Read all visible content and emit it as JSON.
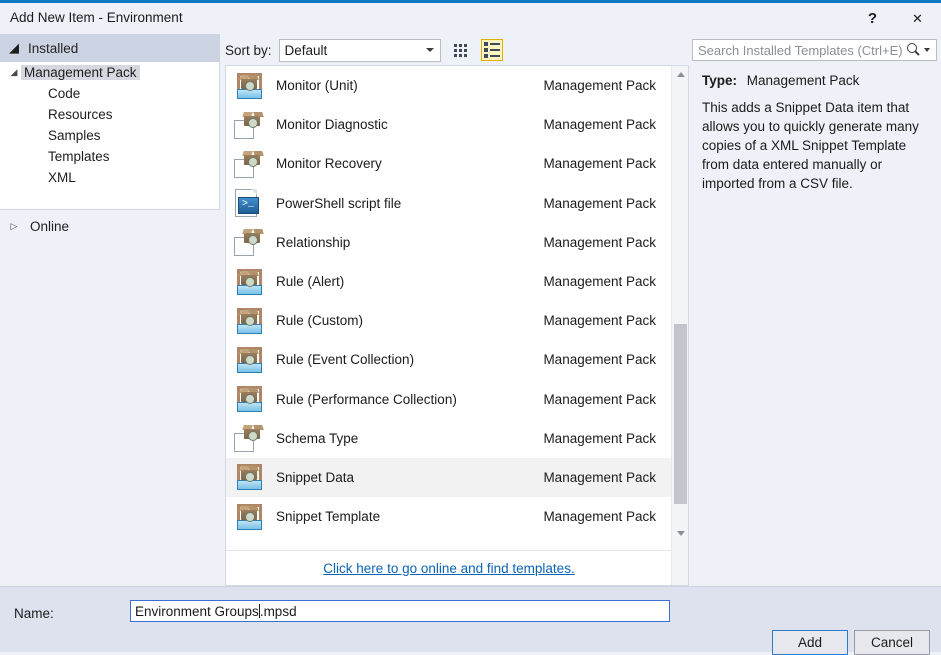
{
  "window": {
    "title": "Add New Item - Environment",
    "help_label": "?",
    "close_label": "✕"
  },
  "sidebar": {
    "installed": {
      "label": "Installed",
      "caret": "◢"
    },
    "tree": [
      {
        "label": "Management Pack",
        "level": 1,
        "caret": "◢",
        "selected": true
      },
      {
        "label": "Code",
        "level": 2,
        "caret": "",
        "selected": false
      },
      {
        "label": "Resources",
        "level": 2,
        "caret": "",
        "selected": false
      },
      {
        "label": "Samples",
        "level": 2,
        "caret": "",
        "selected": false
      },
      {
        "label": "Templates",
        "level": 2,
        "caret": "",
        "selected": false
      },
      {
        "label": "XML",
        "level": 2,
        "caret": "",
        "selected": false
      }
    ],
    "online": {
      "label": "Online",
      "caret": "▷"
    }
  },
  "toolbar": {
    "sort_by_label": "Sort by:",
    "sort_by_value": "Default",
    "view_medium_icons": "medium-icons-view",
    "view_list": "list-view",
    "active_view": "list-view"
  },
  "search": {
    "placeholder": "Search Installed Templates (Ctrl+E)",
    "value": "",
    "icon": "search-icon"
  },
  "templates": [
    {
      "name": "Monitor (Unit)",
      "type": "Management Pack",
      "icon": "tray-box-icon",
      "selected": false
    },
    {
      "name": "Monitor Diagnostic",
      "type": "Management Pack",
      "icon": "doc-box-icon",
      "selected": false
    },
    {
      "name": "Monitor Recovery",
      "type": "Management Pack",
      "icon": "doc-box-icon",
      "selected": false
    },
    {
      "name": "PowerShell script file",
      "type": "Management Pack",
      "icon": "powershell-icon",
      "selected": false
    },
    {
      "name": "Relationship",
      "type": "Management Pack",
      "icon": "doc-box-icon",
      "selected": false
    },
    {
      "name": "Rule (Alert)",
      "type": "Management Pack",
      "icon": "tray-box-icon",
      "selected": false
    },
    {
      "name": "Rule (Custom)",
      "type": "Management Pack",
      "icon": "tray-box-icon",
      "selected": false
    },
    {
      "name": "Rule (Event Collection)",
      "type": "Management Pack",
      "icon": "tray-box-icon",
      "selected": false
    },
    {
      "name": "Rule (Performance Collection)",
      "type": "Management Pack",
      "icon": "tray-box-icon",
      "selected": false
    },
    {
      "name": "Schema Type",
      "type": "Management Pack",
      "icon": "doc-box-icon",
      "selected": false
    },
    {
      "name": "Snippet Data",
      "type": "Management Pack",
      "icon": "tray-box-icon",
      "selected": true
    },
    {
      "name": "Snippet Template",
      "type": "Management Pack",
      "icon": "tray-box-icon",
      "selected": false
    },
    {
      "name": "",
      "type": "",
      "icon": "doc-box-icon",
      "selected": false
    }
  ],
  "online_link": "Click here to go online and find templates.",
  "details": {
    "type_label": "Type:",
    "type_value": "Management Pack",
    "description": "This adds a Snippet Data item that allows you to quickly generate many copies of a XML Snippet Template from data entered manually or imported from a CSV file."
  },
  "footer": {
    "name_label": "Name:",
    "name_value": "Environment Groups",
    "name_value_suffix": ".mpsd",
    "add_label": "Add",
    "cancel_label": "Cancel"
  },
  "colors": {
    "accent": "#0e7ac4",
    "dialog_bg": "#eef1f8",
    "selection": "#f2f2f2",
    "link": "#0a63b4",
    "focus_border": "#3b6fd4"
  }
}
